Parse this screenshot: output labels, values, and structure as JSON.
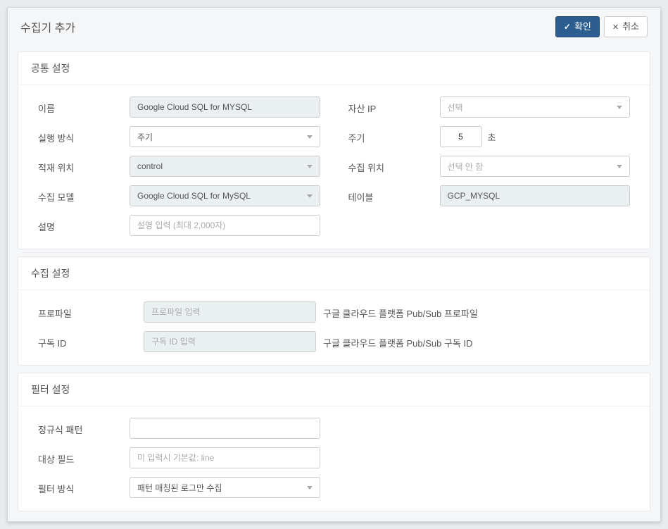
{
  "header": {
    "title": "수집기 추가",
    "confirm": "확인",
    "cancel": "취소"
  },
  "common": {
    "title": "공통 설정",
    "name_label": "이름",
    "name_value": "Google Cloud SQL for MYSQL",
    "asset_ip_label": "자산 IP",
    "asset_ip_placeholder": "선택",
    "run_mode_label": "실행 방식",
    "run_mode_value": "주기",
    "cycle_label": "주기",
    "cycle_value": "5",
    "cycle_unit": "초",
    "load_location_label": "적재 위치",
    "load_location_value": "control",
    "collect_location_label": "수집 위치",
    "collect_location_placeholder": "선택 안 함",
    "collect_model_label": "수집 모델",
    "collect_model_value": "Google Cloud SQL for MySQL",
    "table_label": "테이블",
    "table_value": "GCP_MYSQL",
    "description_label": "설명",
    "description_placeholder": "설명 입력 (최대 2,000자)"
  },
  "collect": {
    "title": "수집 설정",
    "profile_label": "프로파일",
    "profile_placeholder": "프로파일 입력",
    "profile_desc": "구글 클라우드 플랫폼 Pub/Sub 프로파일",
    "subscription_label": "구독 ID",
    "subscription_placeholder": "구독 ID 입력",
    "subscription_desc": "구글 클라우드 플랫폼 Pub/Sub 구독 ID"
  },
  "filter": {
    "title": "필터 설정",
    "regex_label": "정규식 패턴",
    "target_field_label": "대상 필드",
    "target_field_placeholder": "미 입력시 기본값: line",
    "filter_mode_label": "필터 방식",
    "filter_mode_value": "패턴 매칭된 로그만 수집"
  }
}
